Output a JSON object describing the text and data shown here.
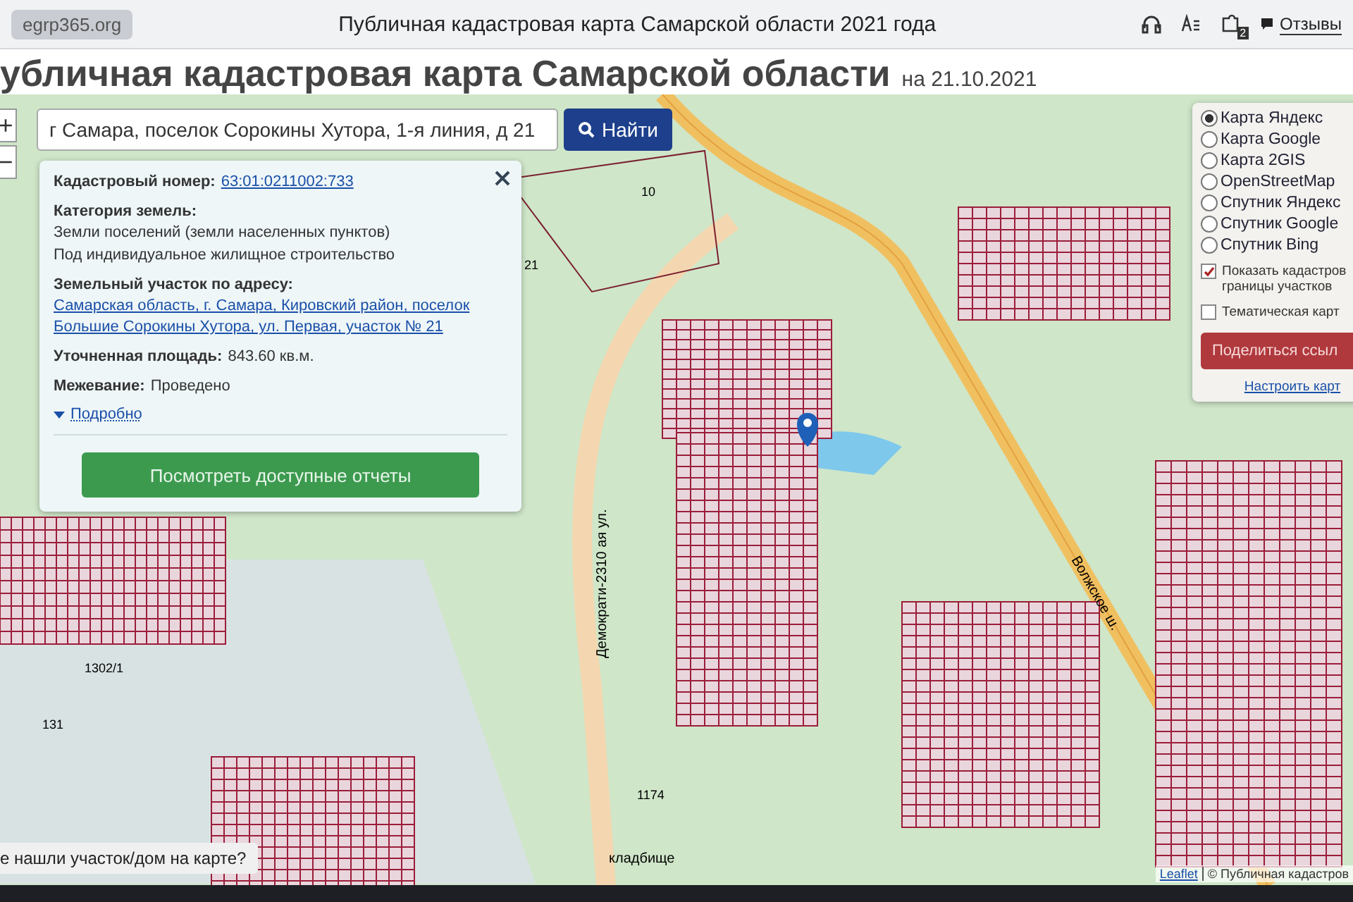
{
  "browser": {
    "address": "egrp365.org",
    "title": "Публичная кадастровая карта Самарской области 2021 года",
    "notification_count": "2",
    "feedback": "Отзывы"
  },
  "heading": {
    "title": "убличная кадастровая карта Самарской области",
    "date": "на 21.10.2021"
  },
  "zoom": {
    "zoom_in": "+",
    "zoom_out": "−"
  },
  "search": {
    "value": "г Самара, поселок Сорокины Хутора, 1-я линия, д 21",
    "button": "Найти"
  },
  "popup": {
    "fields": [
      {
        "label": "Кадастровый номер:",
        "value": "63:01:0211002:733",
        "kind": "link"
      },
      {
        "label": "Категория земель:",
        "value": "Земли поселений (земли населенных пунктов)",
        "note": "Под индивидуальное жилищное строительство",
        "kind": "text"
      },
      {
        "label": "Земельный участок по адресу:",
        "value": "Самарская область, г. Самара, Кировский район, поселок Большие Сорокины Хутора, ул. Первая, участок № 21",
        "kind": "link"
      },
      {
        "label": "Уточненная площадь:",
        "value": "843.60 кв.м.",
        "kind": "text"
      },
      {
        "label": "Межевание:",
        "value": "Проведено",
        "kind": "text"
      }
    ],
    "details": "Подробно",
    "reports_button": "Посмотреть доступные отчеты"
  },
  "layers": {
    "maps": [
      {
        "label": "Карта Яндекс",
        "selected": true
      },
      {
        "label": "Карта Google",
        "selected": false
      },
      {
        "label": "Карта 2GIS",
        "selected": false
      },
      {
        "label": "OpenStreetMap",
        "selected": false
      },
      {
        "label": "Спутник Яндекс",
        "selected": false
      },
      {
        "label": "Спутник Google",
        "selected": false
      },
      {
        "label": "Спутник Bing",
        "selected": false
      }
    ],
    "options": [
      {
        "label": "Показать кадастров\nграницы участков",
        "checked": true
      },
      {
        "label": "Тематическая карт",
        "checked": false
      }
    ],
    "share_button": "Поделиться ссыл",
    "configure_link": "Настроить карт"
  },
  "map_labels": [
    "10",
    "21",
    "1302/1",
    "1174",
    "131",
    "кладбище",
    "Волжское ш.",
    "Демократи-2310 ая ул."
  ],
  "not_found_prompt": "е нашли участок/дом на карте?",
  "attribution": {
    "library": "Leaflet",
    "source": "© Публичная кадастров"
  }
}
